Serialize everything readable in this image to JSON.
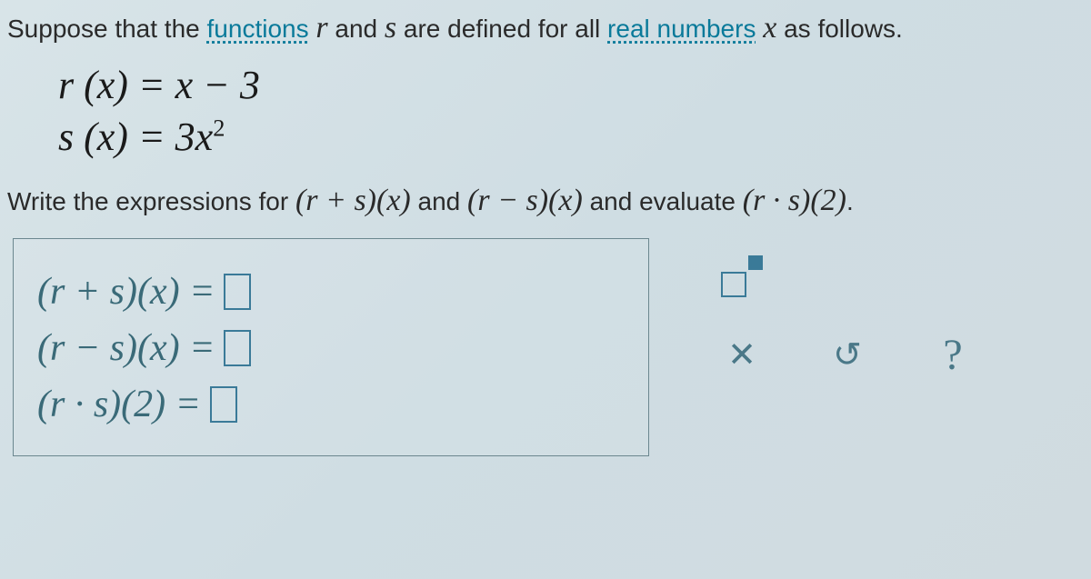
{
  "question": {
    "prefix": "Suppose that the ",
    "link1": "functions",
    "mid1": " ",
    "var_r": "r",
    "and1": " and ",
    "var_s": "s",
    "mid2": " are defined for all ",
    "link2": "real numbers",
    "after_link2": " ",
    "var_x": "x",
    "suffix": " as follows."
  },
  "functions": {
    "r_def": "r (x) = x − 3",
    "s_def_pre": "s (x) = 3x",
    "s_def_exp": "2"
  },
  "instruction": {
    "p1": "Write the expressions for ",
    "e1": "(r + s)(x)",
    "p2": " and ",
    "e2": "(r − s)(x)",
    "p3": " and evaluate ",
    "e3": "(r · s)(2)",
    "p4": "."
  },
  "answers": {
    "line1": "(r + s)(x) = ",
    "line2": "(r − s)(x) = ",
    "line3": "(r · s)(2) = "
  },
  "tools": {
    "exponent": "exponent",
    "clear": "clear",
    "reset": "reset",
    "help": "help"
  }
}
